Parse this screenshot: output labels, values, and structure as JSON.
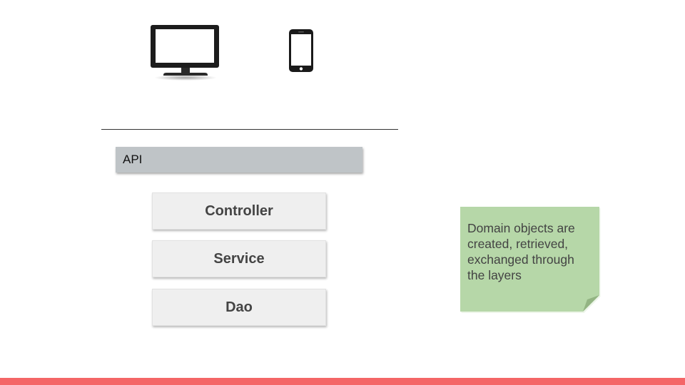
{
  "icons": {
    "desktop": "monitor-icon",
    "mobile": "phone-icon"
  },
  "api": {
    "label": "API"
  },
  "layers": [
    {
      "label": "Controller"
    },
    {
      "label": "Service"
    },
    {
      "label": "Dao"
    }
  ],
  "note": {
    "text": "Domain objects are created, retrieved, exchanged through the layers"
  },
  "colors": {
    "api_bar": "#bfc4c7",
    "layer_box": "#efefef",
    "note": "#b6d7a8",
    "note_fold": "#93b483",
    "accent_bar": "#f46667"
  }
}
